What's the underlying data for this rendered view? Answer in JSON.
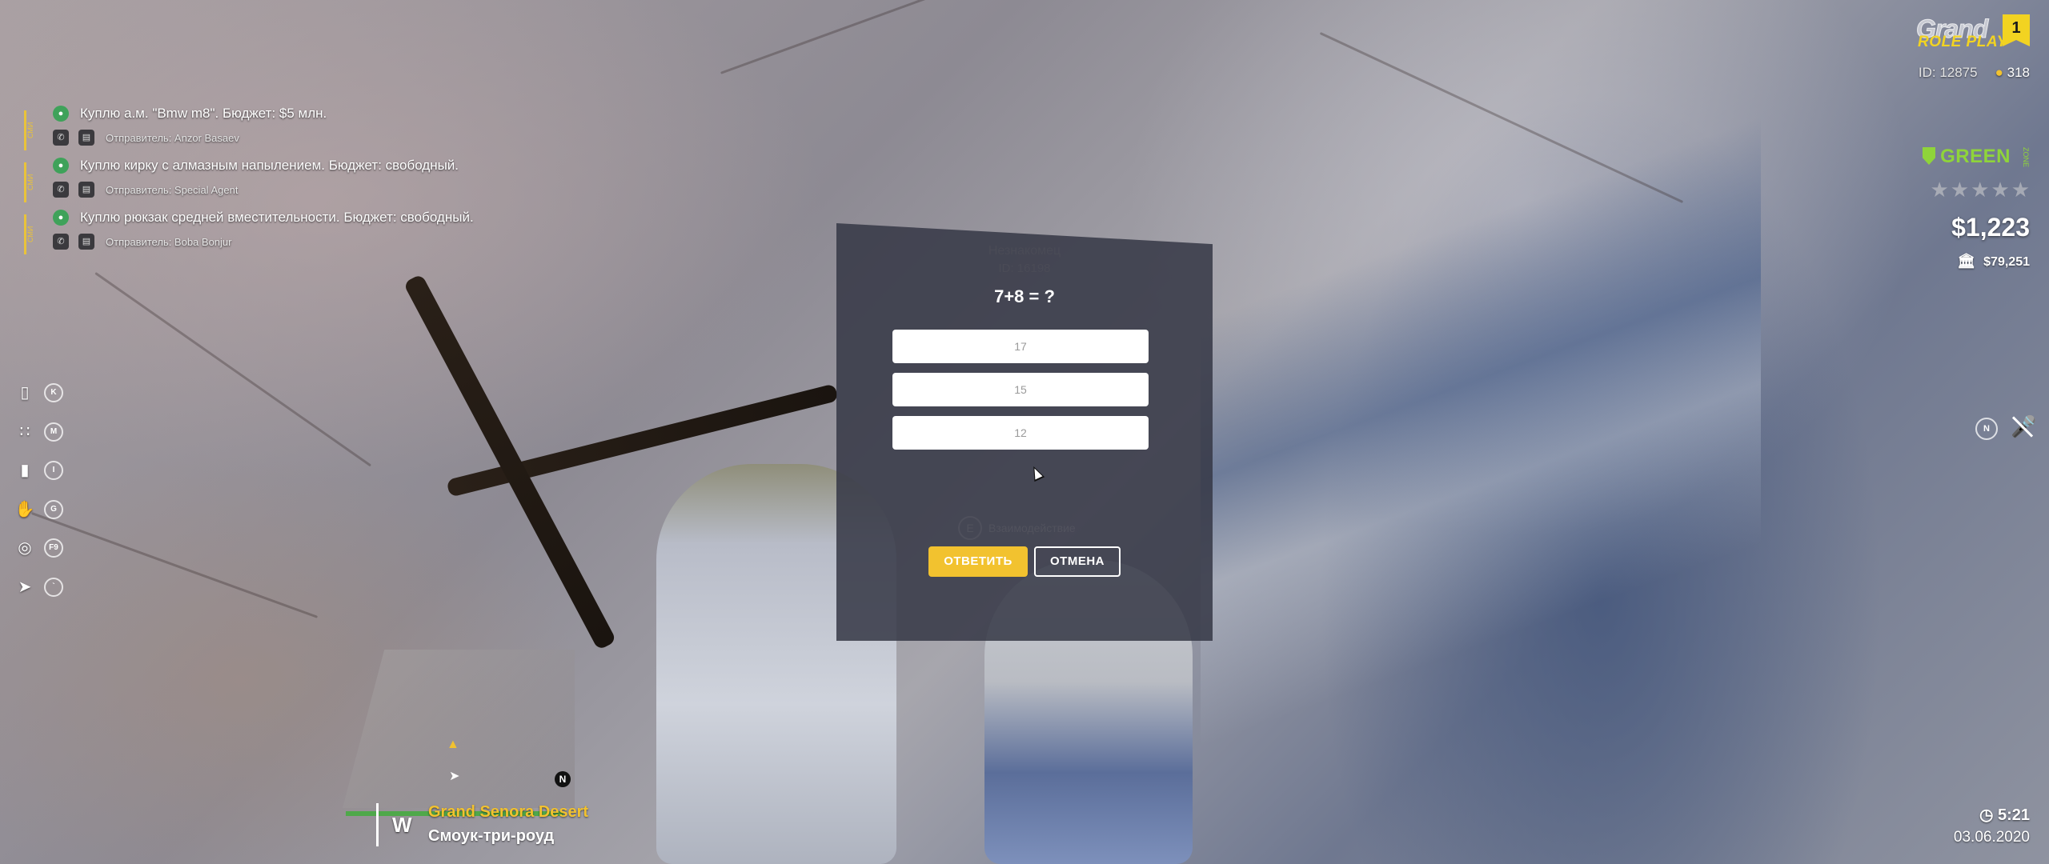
{
  "ads": [
    {
      "tag": "СМИ",
      "text": "Куплю а.м. \"Bmw m8\". Бюджет: $5 млн.",
      "sender": "Отправитель: Anzor Basaev"
    },
    {
      "tag": "СМИ",
      "text": "Куплю кирку с алмазным напылением. Бюджет: свободный.",
      "sender": "Отправитель: Special Agent"
    },
    {
      "tag": "СМИ",
      "text": "Куплю рюкзак средней вместительности. Бюджет: свободный.",
      "sender": "Отправитель: Boba Bonjur"
    }
  ],
  "hotkeys": [
    {
      "icon": "phone-icon",
      "key": "K"
    },
    {
      "icon": "menu-grid-icon",
      "key": "M"
    },
    {
      "icon": "backpack-icon",
      "key": "I"
    },
    {
      "icon": "animation-icon",
      "key": "G"
    },
    {
      "icon": "hide-hud-icon",
      "key": "F9"
    },
    {
      "icon": "cursor-icon",
      "key": "`"
    }
  ],
  "brand": {
    "grand": "Grand",
    "roleplay": "ROLE PLAY",
    "server": "1"
  },
  "player": {
    "id_label": "ID: 12875",
    "online": "318"
  },
  "zone_status": {
    "label": "GREEN",
    "sub": "ZONE",
    "color": "#8fd43a"
  },
  "wanted_level": {
    "stars_total": 5,
    "stars_active": 0
  },
  "money": {
    "cash": "$1,223",
    "bank": "$79,251"
  },
  "voice": {
    "key": "N",
    "muted": true
  },
  "location": {
    "direction": "W",
    "zone": "Grand Senora Desert",
    "street": "Смоук-три-роуд",
    "health": 1.0
  },
  "minimap": {
    "north": "N"
  },
  "time": {
    "clock": "5:21",
    "date": "03.06.2020"
  },
  "captcha": {
    "ghost_title": "Незнакомец",
    "ghost_subtitle": "ID: 16198",
    "question": "7+8 = ?",
    "answers": [
      "17",
      "15",
      "12"
    ],
    "ghost_hint": "Взаимодействие",
    "submit_label": "ОТВЕТИТЬ",
    "cancel_label": "ОТМЕНА"
  },
  "colors": {
    "accent": "#f2c22f",
    "modal_bg": "#363846",
    "health": "#4fa84a"
  }
}
